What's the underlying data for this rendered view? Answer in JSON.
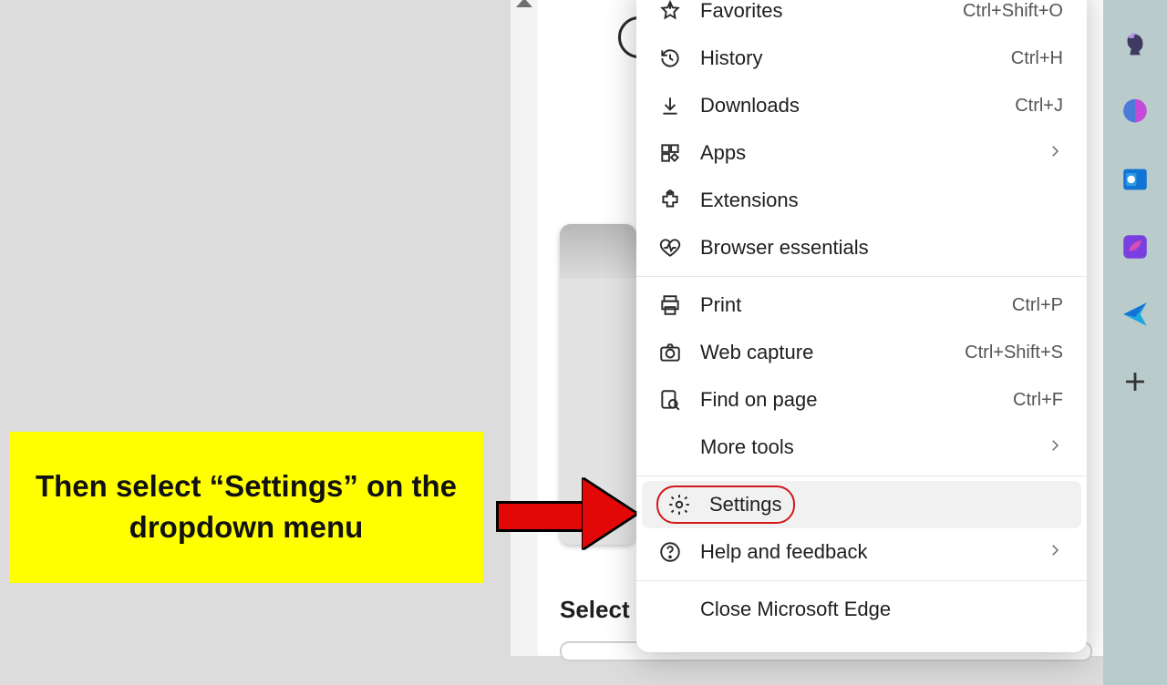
{
  "callout_text": "Then select “Settings” on the dropdown menu",
  "underneath_label": "Select yo",
  "menu": {
    "favorites": {
      "label": "Favorites",
      "shortcut": "Ctrl+Shift+O"
    },
    "history": {
      "label": "History",
      "shortcut": "Ctrl+H"
    },
    "downloads": {
      "label": "Downloads",
      "shortcut": "Ctrl+J"
    },
    "apps": {
      "label": "Apps"
    },
    "extensions": {
      "label": "Extensions"
    },
    "essentials": {
      "label": "Browser essentials"
    },
    "print": {
      "label": "Print",
      "shortcut": "Ctrl+P"
    },
    "capture": {
      "label": "Web capture",
      "shortcut": "Ctrl+Shift+S"
    },
    "find": {
      "label": "Find on page",
      "shortcut": "Ctrl+F"
    },
    "more": {
      "label": "More tools"
    },
    "settings": {
      "label": "Settings"
    },
    "help": {
      "label": "Help and feedback"
    },
    "close": {
      "label": "Close Microsoft Edge"
    }
  }
}
